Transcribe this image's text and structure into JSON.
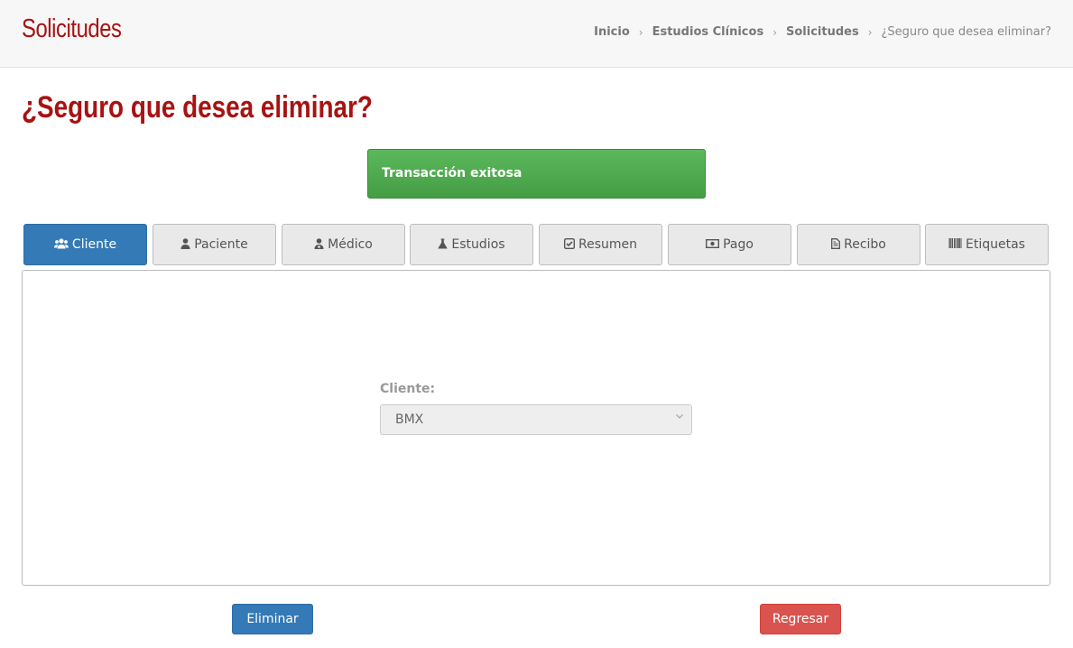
{
  "header": {
    "section_title": "Solicitudes",
    "breadcrumb": {
      "items": [
        "Inicio",
        "Estudios Clínicos",
        "Solicitudes"
      ],
      "current": "¿Seguro que desea eliminar?",
      "separator": "›"
    }
  },
  "page_title": "¿Seguro que desea eliminar?",
  "alert": {
    "text": "Transacción exitosa",
    "color": "#5cb85c"
  },
  "tabs": [
    {
      "label": "Cliente",
      "icon": "users-icon",
      "active": true
    },
    {
      "label": "Paciente",
      "icon": "user-icon",
      "active": false
    },
    {
      "label": "Médico",
      "icon": "user-md-icon",
      "active": false
    },
    {
      "label": "Estudios",
      "icon": "flask-icon",
      "active": false
    },
    {
      "label": "Resumen",
      "icon": "check-square-icon",
      "active": false
    },
    {
      "label": "Pago",
      "icon": "money-icon",
      "active": false
    },
    {
      "label": "Recibo",
      "icon": "file-text-icon",
      "active": false
    },
    {
      "label": "Etiquetas",
      "icon": "barcode-icon",
      "active": false
    }
  ],
  "form": {
    "cliente_label": "Cliente:",
    "cliente_value": "BMX"
  },
  "buttons": {
    "delete_label": "Eliminar",
    "back_label": "Regresar"
  },
  "colors": {
    "title_red": "#a71312",
    "primary_blue": "#337ab7",
    "danger_red": "#d9534f",
    "success_green": "#5cb85c"
  }
}
